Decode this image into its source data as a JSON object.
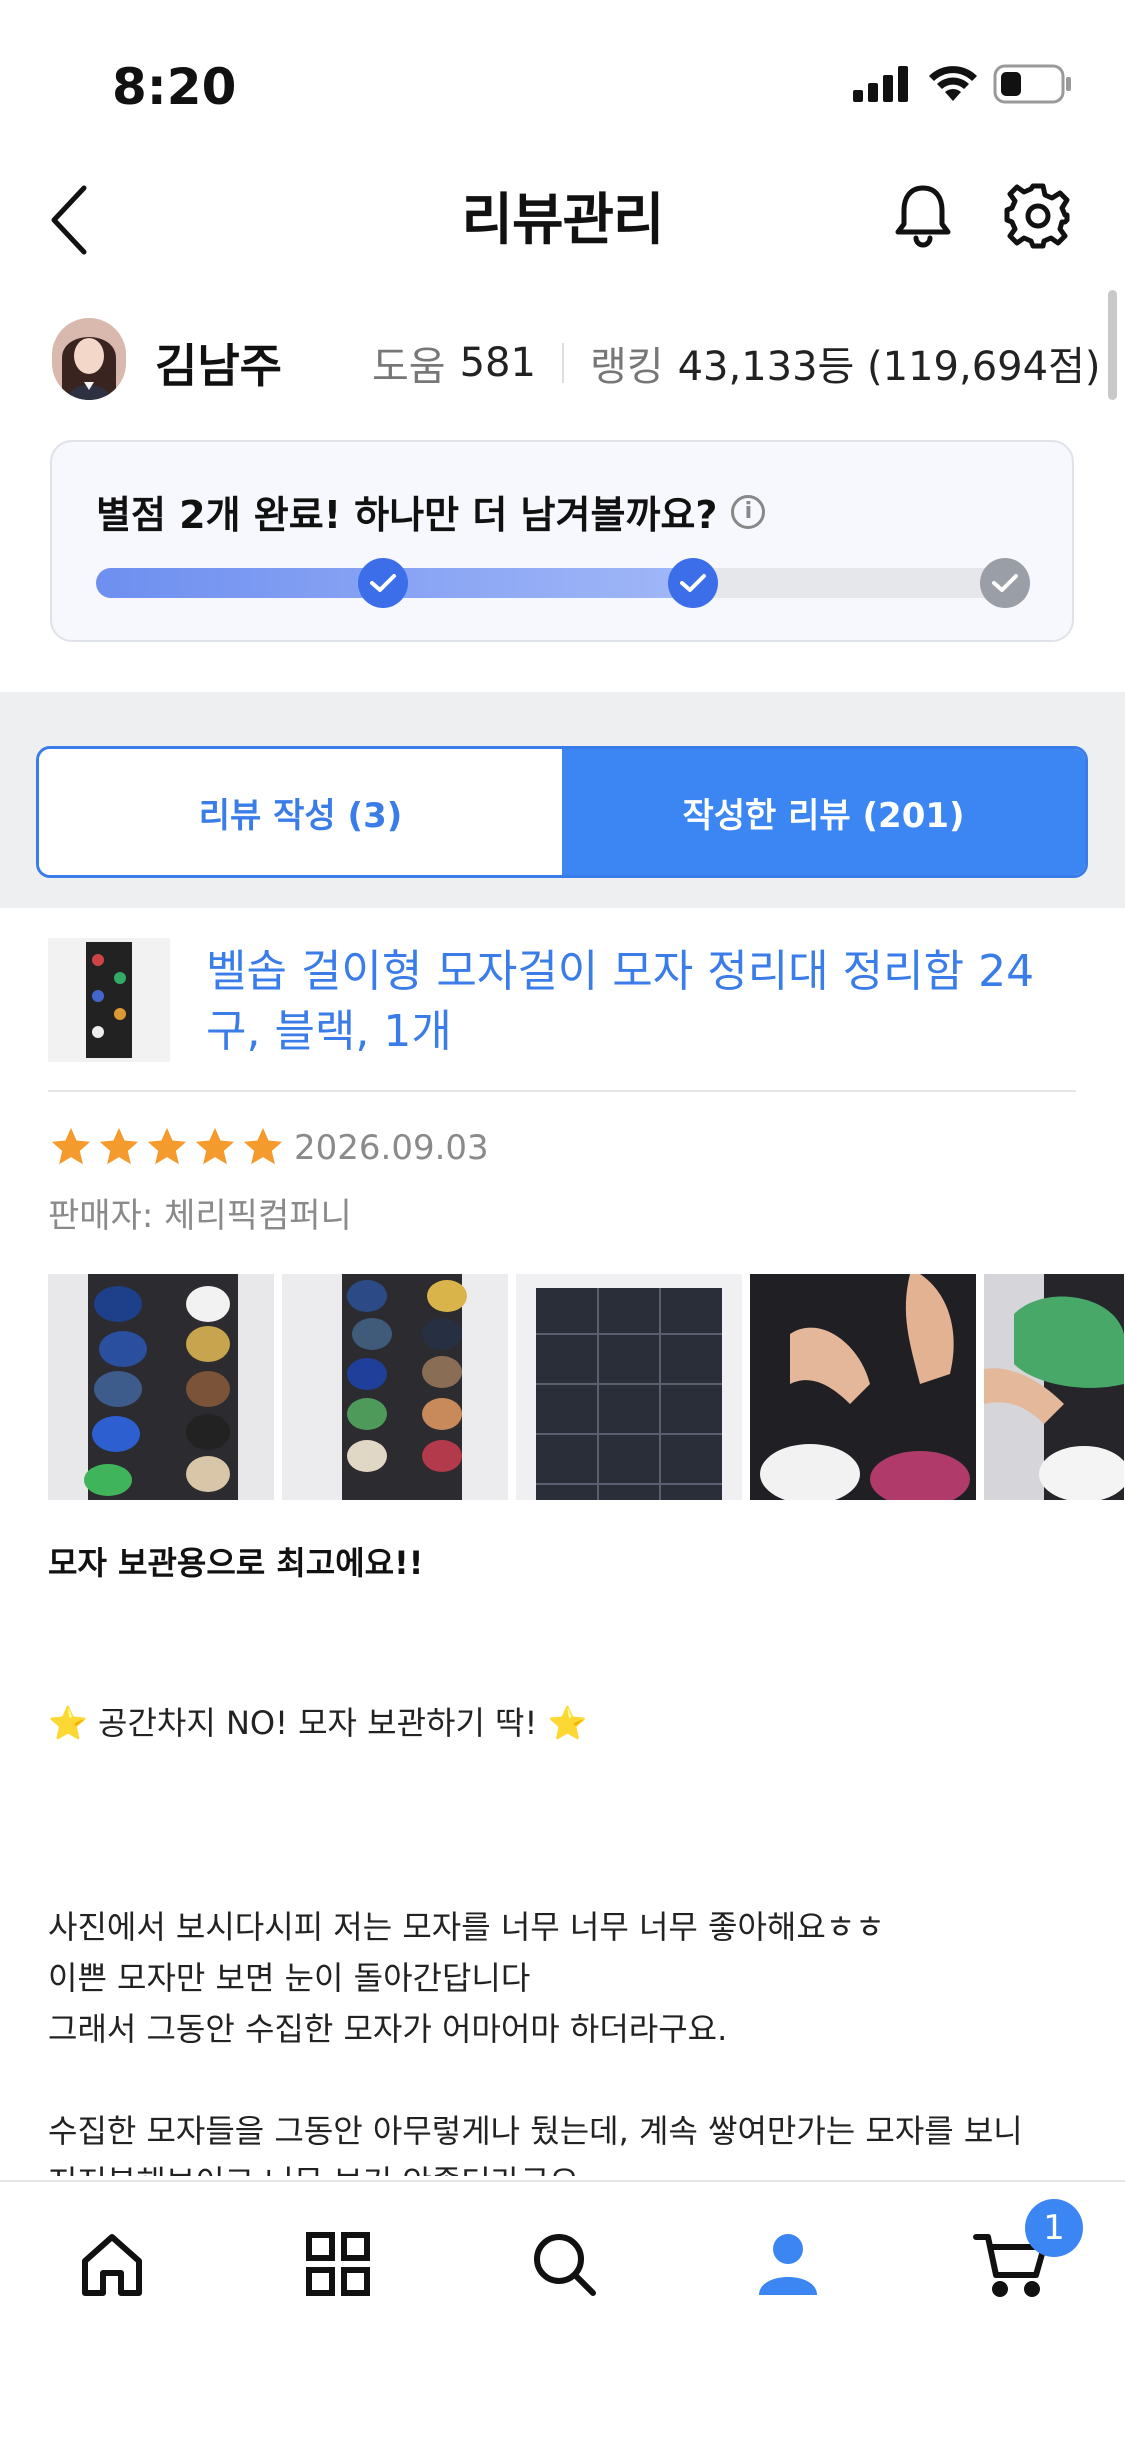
{
  "status_bar": {
    "time": "8:20"
  },
  "header": {
    "title": "리뷰관리"
  },
  "profile": {
    "name": "김남주",
    "help_label": "도움",
    "help_count": "581",
    "rank_label": "랭킹",
    "rank_value": "43,133등 (119,694점)"
  },
  "progress": {
    "message": "별점 2개 완료! 하나만 더 남겨볼까요?",
    "completed_steps": 2,
    "total_steps": 3,
    "fill_fraction": 0.62
  },
  "tabs": [
    {
      "label": "리뷰 작성 (3)",
      "active": false
    },
    {
      "label": "작성한 리뷰 (201)",
      "active": true
    }
  ],
  "review": {
    "product_name": "벨솝 걸이형 모자걸이 모자 정리대 정리함 24구, 블랙, 1개",
    "rating": 5,
    "date": "2026.09.03",
    "seller": "판매자: 체리픽컴퍼니",
    "photo_count_visible": 5,
    "headline": "모자 보관용으로 최고에요!!",
    "subheadline": "⭐ 공간차지 NO! 모자 보관하기 딱! ⭐",
    "body": "사진에서 보시다시피 저는 모자를 너무 너무 너무 좋아해요ㅎㅎ\n이쁜 모자만 보면 눈이 돌아간답니다\n그래서 그동안 수집한 모자가 어마어마 하더라구요.\n\n수집한 모자들을 그동안 아무렇게나 뒀는데, 계속 쌓여만가는 모자를 보니\n지저분해보이고 너무 보기 안좋더라구요.\n내 머리는 하난데 모자가 왤케 많은건지...\n\n어떻게 보관할지 고민하다가 역시 답은 쿠팡에 있었어요ㅋㅋㅋ\n공간차지도 안하고 그냥 문 한쪽에 걸기만 하면되니까 너무 간편하더라구"
  },
  "bottom_nav": {
    "items": [
      "home-icon",
      "category-grid-icon",
      "search-icon",
      "my-profile-icon",
      "cart-icon"
    ],
    "cart_badge": "1"
  },
  "colors": {
    "accent": "#3b86f3",
    "star": "#f59a2c",
    "link": "#3b7de8"
  }
}
